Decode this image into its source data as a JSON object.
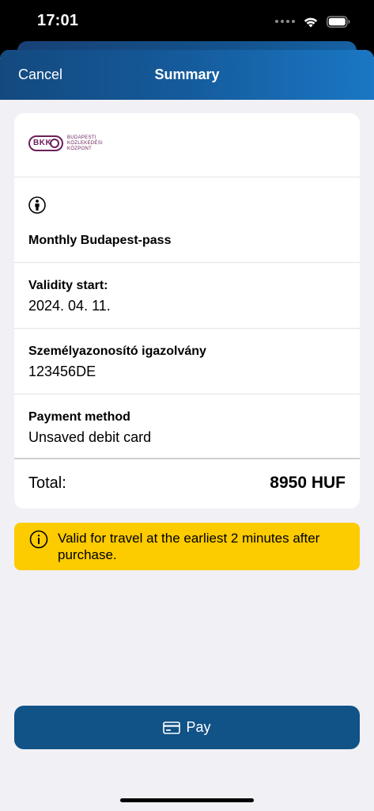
{
  "status_bar": {
    "time": "17:01",
    "icons": [
      "cellular-dots-icon",
      "wifi-icon",
      "battery-icon"
    ]
  },
  "nav": {
    "cancel_label": "Cancel",
    "title": "Summary"
  },
  "logo": {
    "badge": "BKK",
    "lines": [
      "BUDAPESTI",
      "KÖZLEKEDÉSI",
      "KÖZPONT"
    ],
    "color": "#6b1f5a"
  },
  "pass": {
    "icon": "person-icon",
    "name": "Monthly Budapest-pass"
  },
  "validity": {
    "label": "Validity start:",
    "value": "2024. 04. 11."
  },
  "id_document": {
    "label": "Személyazonosító igazolvány",
    "value": "123456DE"
  },
  "payment": {
    "label": "Payment method",
    "value": "Unsaved debit card"
  },
  "total": {
    "label": "Total:",
    "value": "8950 HUF"
  },
  "info": {
    "icon": "info-icon",
    "text": "Valid for travel at the earliest 2 minutes after purchase.",
    "background": "#fccb00"
  },
  "pay_button": {
    "icon": "credit-card-icon",
    "label": "Pay",
    "color": "#115287"
  },
  "colors": {
    "nav_gradient_start": "#13497f",
    "nav_gradient_end": "#1a77c4",
    "background": "#f1f0f5"
  }
}
